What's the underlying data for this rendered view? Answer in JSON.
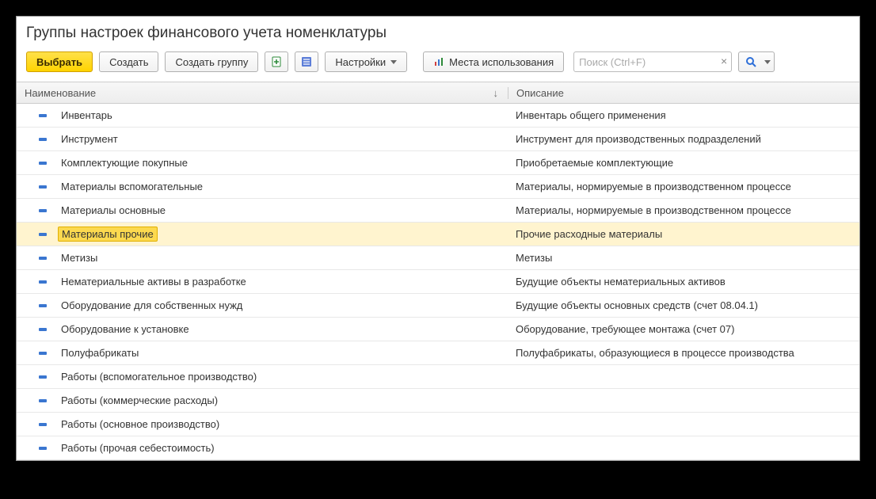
{
  "title": "Группы настроек финансового учета номенклатуры",
  "toolbar": {
    "select_label": "Выбрать",
    "create_label": "Создать",
    "create_group_label": "Создать группу",
    "settings_label": "Настройки",
    "usage_label": "Места использования",
    "search_placeholder": "Поиск (Ctrl+F)"
  },
  "columns": {
    "name": "Наименование",
    "desc": "Описание"
  },
  "rows": [
    {
      "name": "Инвентарь",
      "desc": "Инвентарь общего применения"
    },
    {
      "name": "Инструмент",
      "desc": "Инструмент для производственных подразделений"
    },
    {
      "name": "Комплектующие покупные",
      "desc": "Приобретаемые комплектующие"
    },
    {
      "name": "Материалы вспомогательные",
      "desc": "Материалы, нормируемые в производственном процессе"
    },
    {
      "name": "Материалы основные",
      "desc": "Материалы, нормируемые в производственном процессе"
    },
    {
      "name": "Материалы прочие",
      "desc": "Прочие расходные материалы",
      "selected": true
    },
    {
      "name": "Метизы",
      "desc": "Метизы"
    },
    {
      "name": "Нематериальные активы в разработке",
      "desc": "Будущие объекты нематериальных активов"
    },
    {
      "name": "Оборудование для собственных нужд",
      "desc": "Будущие объекты основных средств (счет 08.04.1)"
    },
    {
      "name": "Оборудование к установке",
      "desc": "Оборудование, требующее монтажа (счет 07)"
    },
    {
      "name": "Полуфабрикаты",
      "desc": "Полуфабрикаты, образующиеся в процессе производства"
    },
    {
      "name": "Работы (вспомогательное производство)",
      "desc": ""
    },
    {
      "name": "Работы (коммерческие расходы)",
      "desc": ""
    },
    {
      "name": "Работы (основное производство)",
      "desc": ""
    },
    {
      "name": "Работы (прочая себестоимость)",
      "desc": ""
    }
  ]
}
